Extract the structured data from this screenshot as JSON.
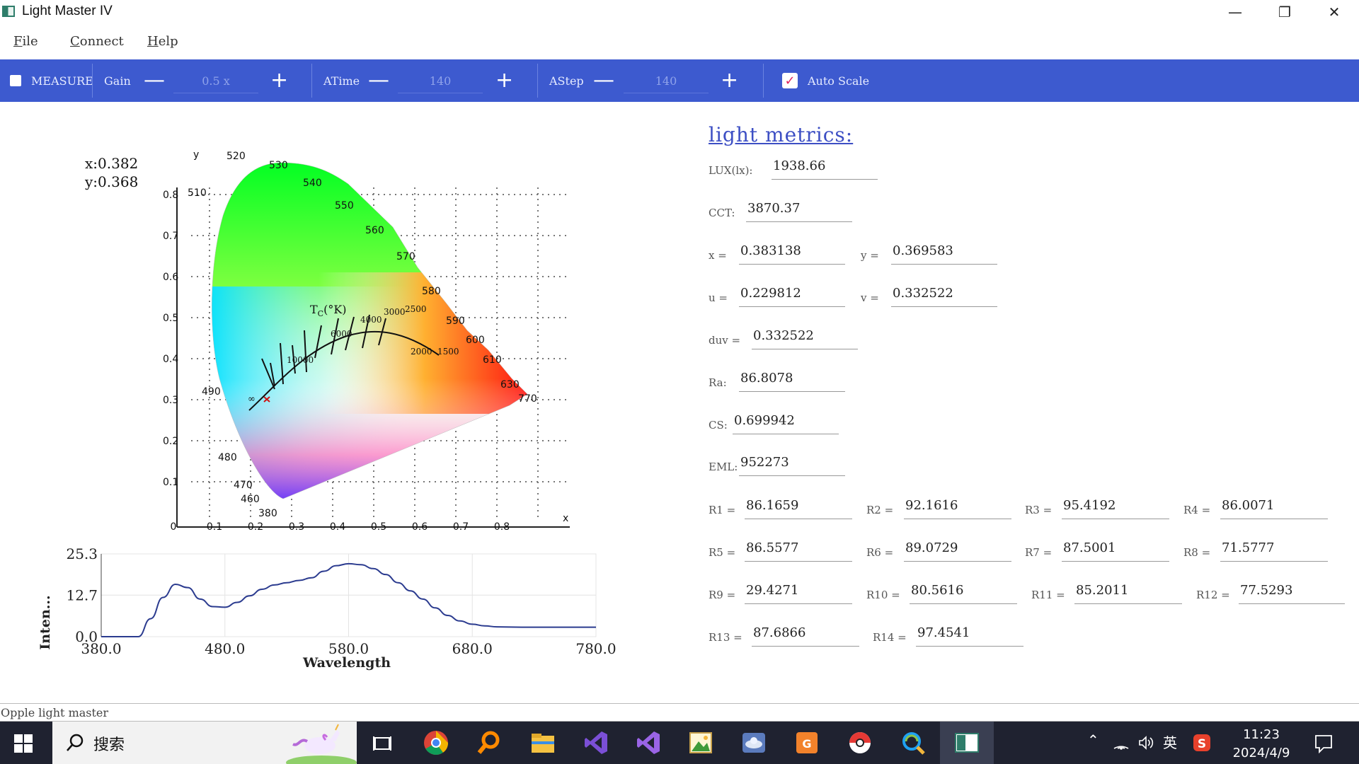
{
  "window": {
    "title": "Light Master IV",
    "minimize": "—",
    "restore": "❐",
    "close": "✕"
  },
  "menu": [
    {
      "label_u": "F",
      "label_rest": "ile"
    },
    {
      "label_u": "C",
      "label_rest": "onnect"
    },
    {
      "label_u": "H",
      "label_rest": "elp"
    }
  ],
  "toolbar": {
    "measure_label": "MEASURE",
    "gain_label": "Gain",
    "gain_value": "0.5 x",
    "atime_label": "ATime",
    "atime_value": "140",
    "astep_label": "AStep",
    "astep_value": "140",
    "minus": "—",
    "plus": "+",
    "auto_scale_label": "Auto Scale",
    "auto_scale_checked": true,
    "accent": "#3d5acf"
  },
  "readout": {
    "x": "x:0.382",
    "y": "y:0.368"
  },
  "cie": {
    "axis_x": "x",
    "axis_y": "y",
    "x_ticks": [
      "0",
      "0.1",
      "0.2",
      "0.3",
      "0.4",
      "0.5",
      "0.6",
      "0.7",
      "0.8"
    ],
    "y_ticks": [
      "0.1",
      "0.2",
      "0.3",
      "0.4",
      "0.5",
      "0.6",
      "0.7",
      "0.8"
    ],
    "wavelength_labels": [
      "520",
      "530",
      "540",
      "550",
      "560",
      "570",
      "580",
      "590",
      "600",
      "610",
      "630",
      "770",
      "510",
      "490",
      "480",
      "470",
      "460",
      "380"
    ],
    "tc_label": "T",
    "tc_sub": "C",
    "tc_unit": "(°K)",
    "cct_labels": [
      "10000",
      "6000",
      "4000",
      "3000",
      "2500",
      "2000",
      "1500",
      "∞"
    ]
  },
  "chart_data": {
    "type": "line",
    "title": "",
    "xlabel": "Wavelength",
    "ylabel": "Inten...",
    "xlim": [
      380,
      780
    ],
    "ylim": [
      0,
      25.3
    ],
    "x_ticks": [
      "380.0",
      "480.0",
      "580.0",
      "680.0",
      "780.0"
    ],
    "y_ticks": [
      "0.0",
      "12.7",
      "25.3"
    ],
    "x": [
      380,
      410,
      420,
      430,
      440,
      450,
      460,
      470,
      480,
      490,
      500,
      510,
      520,
      530,
      540,
      550,
      560,
      570,
      580,
      590,
      600,
      610,
      620,
      630,
      640,
      650,
      660,
      670,
      680,
      690,
      700,
      720,
      740,
      760,
      780
    ],
    "series": [
      {
        "values": [
          0,
          0,
          5.5,
          12.0,
          16.0,
          15.0,
          11.5,
          9.2,
          9.0,
          10.5,
          12.5,
          14.5,
          15.8,
          16.5,
          17.2,
          18.0,
          20.0,
          21.7,
          22.3,
          22.0,
          20.8,
          19.0,
          16.5,
          14.0,
          11.5,
          8.8,
          6.5,
          4.8,
          3.8,
          3.3,
          3.0,
          2.9,
          2.9,
          2.9,
          2.9
        ],
        "color": "#2b3b8f"
      }
    ]
  },
  "metrics": {
    "title": "light metrics:",
    "lux_label": "LUX(lx):",
    "lux": "1938.66",
    "cct_label": "CCT:",
    "cct": "3870.37",
    "x_label": "x =",
    "x": "0.383138",
    "y_label": "y =",
    "y": "0.369583",
    "u_label": "u =",
    "u": "0.229812",
    "v_label": "v =",
    "v": "0.332522",
    "duv_label": "duv =",
    "duv": "0.332522",
    "ra_label": "Ra:",
    "ra": "86.8078",
    "cs_label": "CS:",
    "cs": "0.699942",
    "eml_label": "EML:",
    "eml": "952273",
    "r": [
      {
        "label": "R1 =",
        "value": "86.1659"
      },
      {
        "label": "R2 =",
        "value": "92.1616"
      },
      {
        "label": "R3 =",
        "value": "95.4192"
      },
      {
        "label": "R4 =",
        "value": "86.0071"
      },
      {
        "label": "R5 =",
        "value": "86.5577"
      },
      {
        "label": "R6 =",
        "value": "89.0729"
      },
      {
        "label": "R7 =",
        "value": "87.5001"
      },
      {
        "label": "R8 =",
        "value": "71.5777"
      },
      {
        "label": "R9 =",
        "value": "29.4271"
      },
      {
        "label": "R10 =",
        "value": "80.5616"
      },
      {
        "label": "R11 =",
        "value": "85.2011"
      },
      {
        "label": "R12 =",
        "value": "77.5293"
      },
      {
        "label": "R13 =",
        "value": "87.6866"
      },
      {
        "label": "R14 =",
        "value": "97.4541"
      }
    ]
  },
  "status": "Opple light master",
  "taskbar": {
    "search_text": "搜索",
    "tray_ime": "英",
    "time": "11:23",
    "date": "2024/4/9"
  }
}
